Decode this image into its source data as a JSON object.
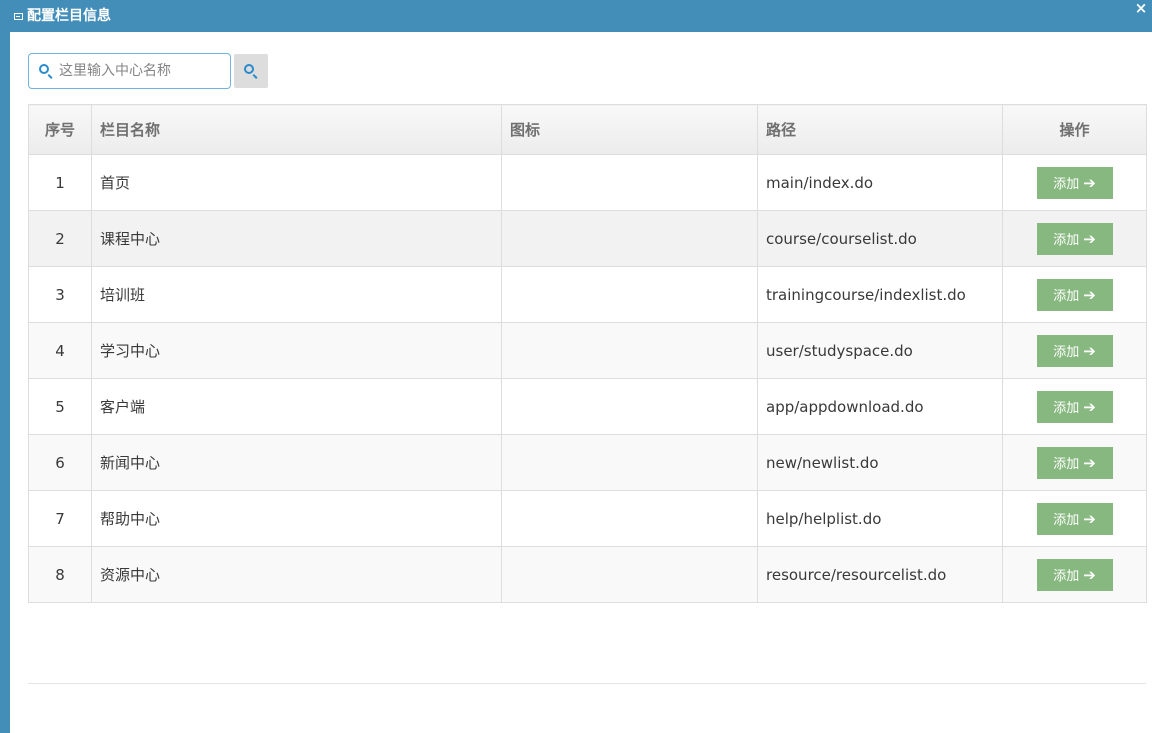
{
  "dialog": {
    "title": "配置栏目信息",
    "title_icon": "list-icon",
    "close_label": "×"
  },
  "search": {
    "placeholder": "这里输入中心名称",
    "value": "",
    "icon": "search-icon"
  },
  "table": {
    "headers": {
      "index": "序号",
      "name": "栏目名称",
      "icon": "图标",
      "path": "路径",
      "action": "操作"
    },
    "rows": [
      {
        "index": "1",
        "name": "首页",
        "icon": "",
        "path": "main/index.do",
        "action": "添加"
      },
      {
        "index": "2",
        "name": "课程中心",
        "icon": "",
        "path": "course/courselist.do",
        "action": "添加"
      },
      {
        "index": "3",
        "name": "培训班",
        "icon": "",
        "path": "trainingcourse/indexlist.do",
        "action": "添加"
      },
      {
        "index": "4",
        "name": "学习中心",
        "icon": "",
        "path": "user/studyspace.do",
        "action": "添加"
      },
      {
        "index": "5",
        "name": "客户端",
        "icon": "",
        "path": "app/appdownload.do",
        "action": "添加"
      },
      {
        "index": "6",
        "name": "新闻中心",
        "icon": "",
        "path": "new/newlist.do",
        "action": "添加"
      },
      {
        "index": "7",
        "name": "帮助中心",
        "icon": "",
        "path": "help/helplist.do",
        "action": "添加"
      },
      {
        "index": "8",
        "name": "资源中心",
        "icon": "",
        "path": "resource/resourcelist.do",
        "action": "添加"
      }
    ]
  },
  "colors": {
    "title_bar": "#438eb9",
    "add_button": "#87b87f",
    "search_border": "#6fb3e0"
  }
}
